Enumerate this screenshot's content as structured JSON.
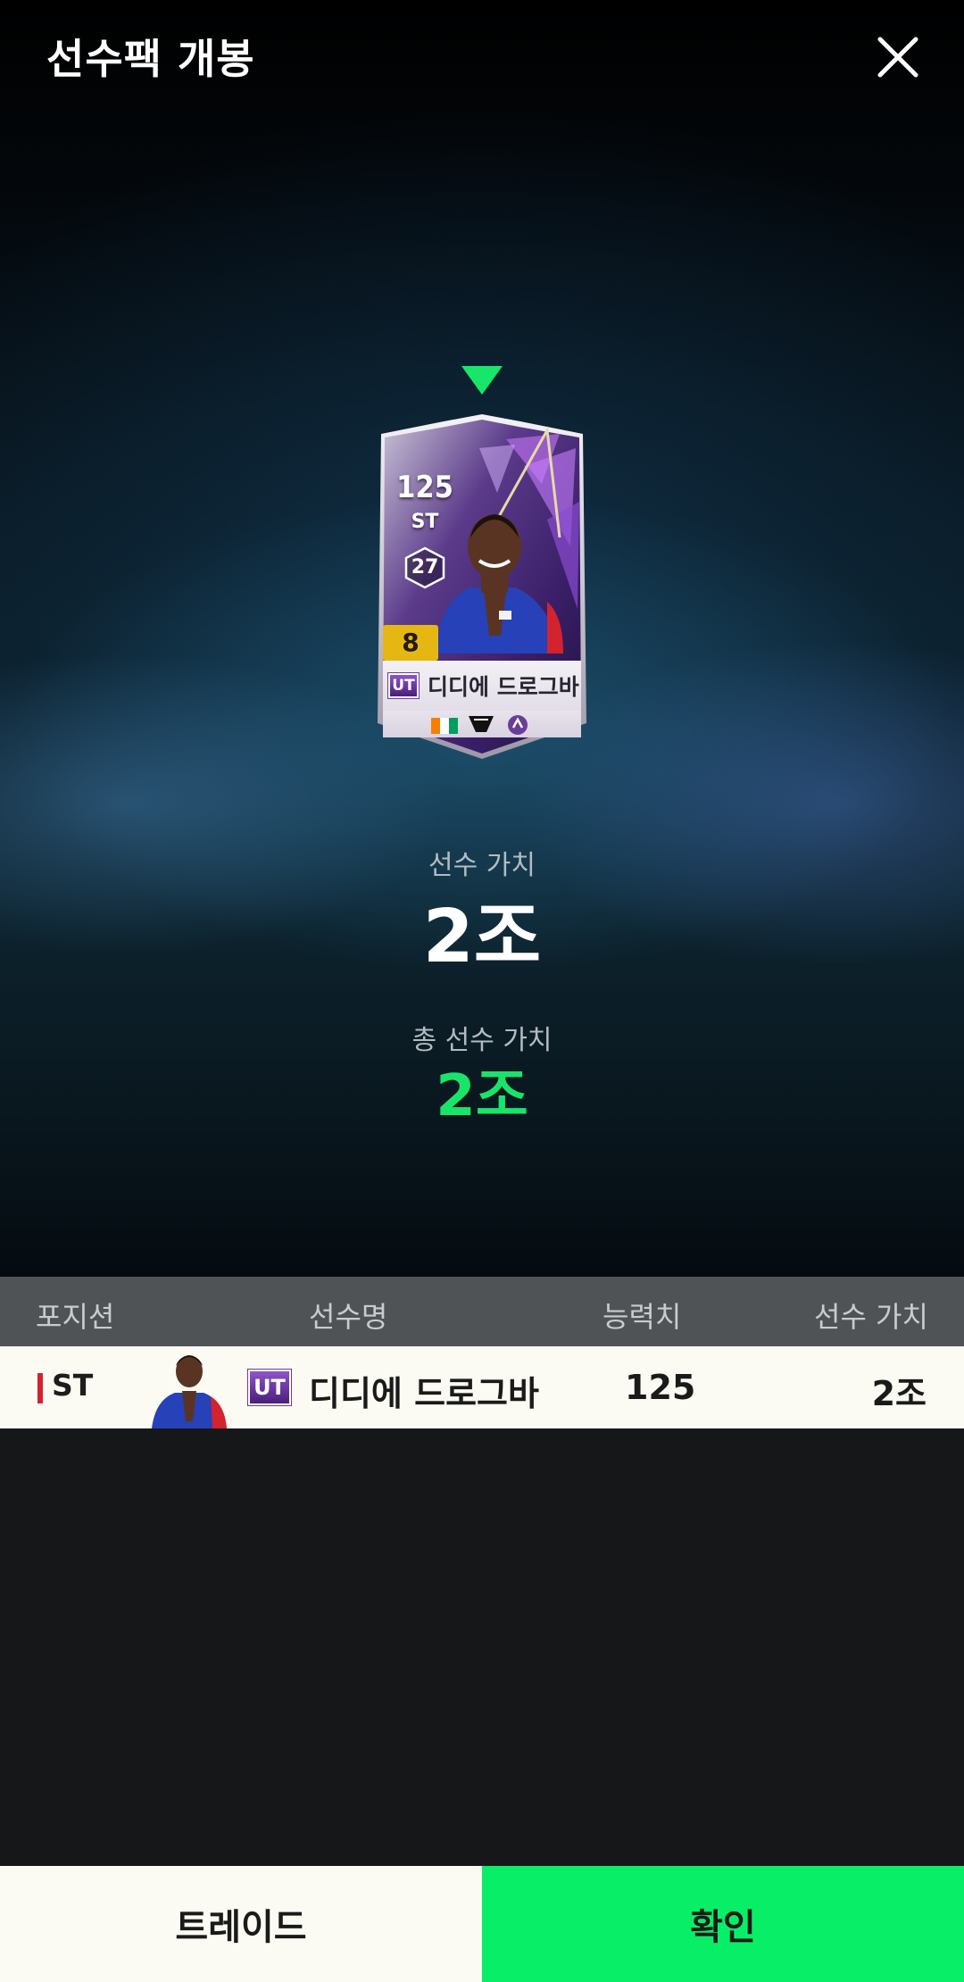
{
  "header": {
    "title": "선수팩 개봉",
    "close_icon": "close-icon"
  },
  "card": {
    "ovr": "125",
    "position": "ST",
    "hex_number": "27",
    "grade": "8",
    "season_badge": "UT",
    "name": "디디에 드로그바",
    "flag_icon": "ivory-coast-flag-icon",
    "club_icon": "club-crest-icon",
    "season_icon": "season-emblem-icon"
  },
  "values": {
    "player_value_label": "선수 가치",
    "player_value": "2조",
    "total_value_label": "총 선수 가치",
    "total_value": "2조"
  },
  "table": {
    "headers": {
      "position": "포지션",
      "name": "선수명",
      "ovr": "능력치",
      "value": "선수 가치"
    },
    "rows": [
      {
        "position": "ST",
        "season_badge": "UT",
        "name": "디디에 드로그바",
        "ovr": "125",
        "value": "2조"
      }
    ]
  },
  "footer": {
    "trade_label": "트레이드",
    "confirm_label": "확인"
  },
  "colors": {
    "accent_green": "#08ef67",
    "total_value_green": "#19e46a",
    "grade_gold": "#e6b713",
    "position_red": "#d3232f",
    "season_purple": "#6a3d9a"
  }
}
